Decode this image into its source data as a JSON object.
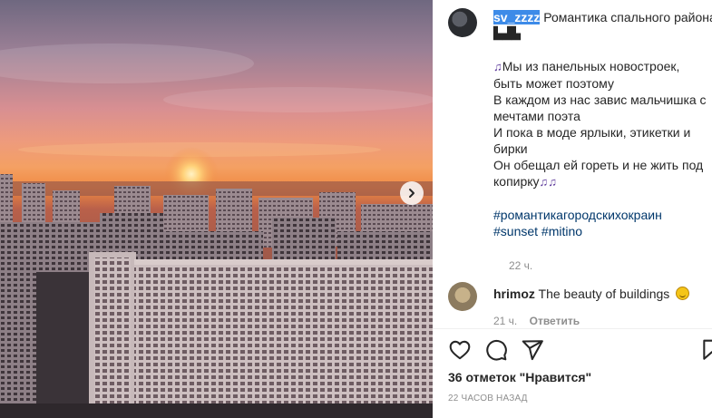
{
  "post": {
    "username": "sv_zzzz",
    "caption_title": "Романтика спального района",
    "caption_lines": [
      "Мы из панельных новостроек,",
      "быть может поэтому",
      "В каждом из нас завис мальчишка с",
      "мечтами поэта",
      "И пока в моде ярлыки, этикетки и",
      "бирки",
      "Он обещал ей гореть и не жить под",
      "копирку"
    ],
    "hashtags_line1": "#романтикагородскихокраин",
    "hashtags_line2": "#sunset #mitino",
    "time": "22 ч."
  },
  "comment": {
    "username": "hrimoz",
    "text": "The beauty of buildings",
    "time": "21 ч.",
    "reply_label": "Ответить"
  },
  "likes": "36 отметок \"Нравится\"",
  "date": "22 ЧАСОВ НАЗАД",
  "icons": {
    "city_emoji": "cityscape-icon",
    "music_emoji": "music-notes-icon",
    "like": "heart-icon",
    "comment": "comment-icon",
    "share": "share-icon",
    "save": "bookmark-icon",
    "next": "chevron-right-icon"
  },
  "colors": {
    "selection": "#3d8be8",
    "hashtag": "#00376b",
    "muted": "#8e8e8e",
    "sun": "#ffd27a",
    "sky_top": "#6f6880",
    "sky_glow": "#f08a42"
  }
}
